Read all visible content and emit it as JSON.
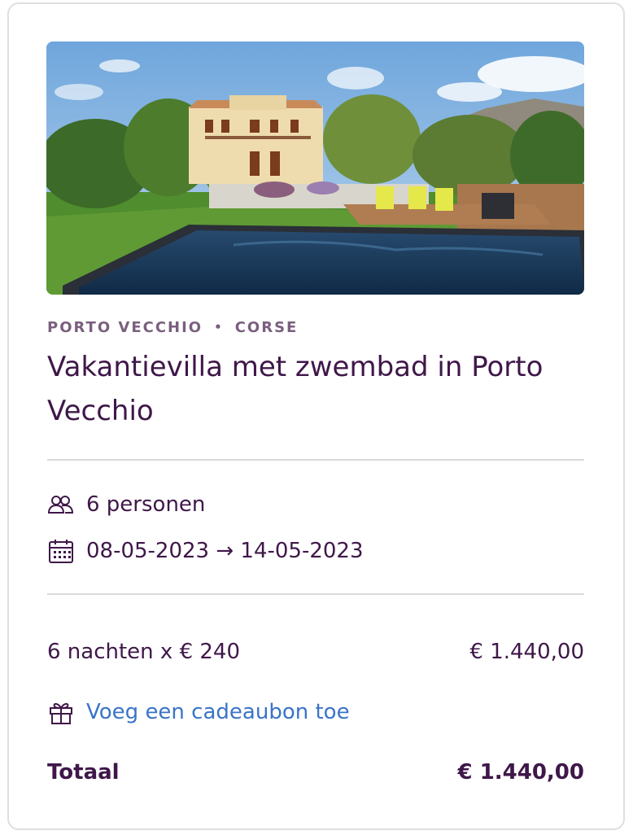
{
  "listing": {
    "region": "PORTO VECCHIO",
    "separator": "•",
    "area": "CORSE",
    "title": "Vakantievilla met zwembad in Porto Vecchio"
  },
  "stay": {
    "guests": "6 personen",
    "dates": "08-05-2023 → 14-05-2023"
  },
  "pricing": {
    "nights_line": "6 nachten x € 240",
    "nights_total": "€ 1.440,00",
    "voucher_link": "Voeg een cadeaubon toe",
    "total_label": "Totaal",
    "total_value": "€ 1.440,00"
  },
  "icons": {
    "guests": "users-icon",
    "dates": "calendar-icon",
    "voucher": "gift-icon"
  },
  "colors": {
    "heading": "#3f1749",
    "location": "#7a5f7e",
    "link": "#3a74c8"
  }
}
